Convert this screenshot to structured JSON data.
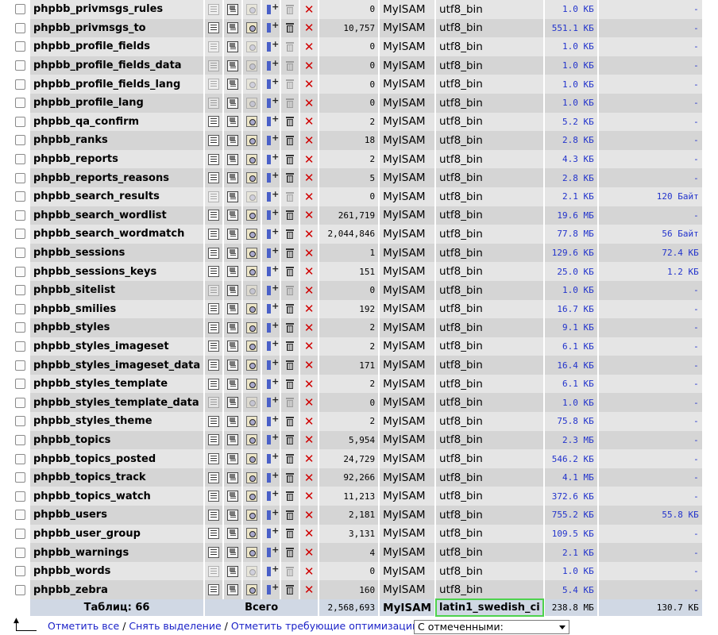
{
  "tables": [
    {
      "name": "phpbb_privmsgs_rules",
      "rows": "0",
      "engine": "MyISAM",
      "collation": "utf8_bin",
      "size": "1.0 КБ",
      "overhead": "-",
      "empty": true
    },
    {
      "name": "phpbb_privmsgs_to",
      "rows": "10,757",
      "engine": "MyISAM",
      "collation": "utf8_bin",
      "size": "551.1 КБ",
      "overhead": "-",
      "empty": false
    },
    {
      "name": "phpbb_profile_fields",
      "rows": "0",
      "engine": "MyISAM",
      "collation": "utf8_bin",
      "size": "1.0 КБ",
      "overhead": "-",
      "empty": true
    },
    {
      "name": "phpbb_profile_fields_data",
      "rows": "0",
      "engine": "MyISAM",
      "collation": "utf8_bin",
      "size": "1.0 КБ",
      "overhead": "-",
      "empty": true
    },
    {
      "name": "phpbb_profile_fields_lang",
      "rows": "0",
      "engine": "MyISAM",
      "collation": "utf8_bin",
      "size": "1.0 КБ",
      "overhead": "-",
      "empty": true
    },
    {
      "name": "phpbb_profile_lang",
      "rows": "0",
      "engine": "MyISAM",
      "collation": "utf8_bin",
      "size": "1.0 КБ",
      "overhead": "-",
      "empty": true
    },
    {
      "name": "phpbb_qa_confirm",
      "rows": "2",
      "engine": "MyISAM",
      "collation": "utf8_bin",
      "size": "5.2 КБ",
      "overhead": "-",
      "empty": false
    },
    {
      "name": "phpbb_ranks",
      "rows": "18",
      "engine": "MyISAM",
      "collation": "utf8_bin",
      "size": "2.8 КБ",
      "overhead": "-",
      "empty": false
    },
    {
      "name": "phpbb_reports",
      "rows": "2",
      "engine": "MyISAM",
      "collation": "utf8_bin",
      "size": "4.3 КБ",
      "overhead": "-",
      "empty": false
    },
    {
      "name": "phpbb_reports_reasons",
      "rows": "5",
      "engine": "MyISAM",
      "collation": "utf8_bin",
      "size": "2.8 КБ",
      "overhead": "-",
      "empty": false
    },
    {
      "name": "phpbb_search_results",
      "rows": "0",
      "engine": "MyISAM",
      "collation": "utf8_bin",
      "size": "2.1 КБ",
      "overhead": "120 Байт",
      "empty": true
    },
    {
      "name": "phpbb_search_wordlist",
      "rows": "261,719",
      "engine": "MyISAM",
      "collation": "utf8_bin",
      "size": "19.6 МБ",
      "overhead": "-",
      "empty": false
    },
    {
      "name": "phpbb_search_wordmatch",
      "rows": "2,044,846",
      "engine": "MyISAM",
      "collation": "utf8_bin",
      "size": "77.8 МБ",
      "overhead": "56 Байт",
      "empty": false
    },
    {
      "name": "phpbb_sessions",
      "rows": "1",
      "engine": "MyISAM",
      "collation": "utf8_bin",
      "size": "129.6 КБ",
      "overhead": "72.4 КБ",
      "empty": false
    },
    {
      "name": "phpbb_sessions_keys",
      "rows": "151",
      "engine": "MyISAM",
      "collation": "utf8_bin",
      "size": "25.0 КБ",
      "overhead": "1.2 КБ",
      "empty": false
    },
    {
      "name": "phpbb_sitelist",
      "rows": "0",
      "engine": "MyISAM",
      "collation": "utf8_bin",
      "size": "1.0 КБ",
      "overhead": "-",
      "empty": true
    },
    {
      "name": "phpbb_smilies",
      "rows": "192",
      "engine": "MyISAM",
      "collation": "utf8_bin",
      "size": "16.7 КБ",
      "overhead": "-",
      "empty": false
    },
    {
      "name": "phpbb_styles",
      "rows": "2",
      "engine": "MyISAM",
      "collation": "utf8_bin",
      "size": "9.1 КБ",
      "overhead": "-",
      "empty": false
    },
    {
      "name": "phpbb_styles_imageset",
      "rows": "2",
      "engine": "MyISAM",
      "collation": "utf8_bin",
      "size": "6.1 КБ",
      "overhead": "-",
      "empty": false
    },
    {
      "name": "phpbb_styles_imageset_data",
      "rows": "171",
      "engine": "MyISAM",
      "collation": "utf8_bin",
      "size": "16.4 КБ",
      "overhead": "-",
      "empty": false
    },
    {
      "name": "phpbb_styles_template",
      "rows": "2",
      "engine": "MyISAM",
      "collation": "utf8_bin",
      "size": "6.1 КБ",
      "overhead": "-",
      "empty": false
    },
    {
      "name": "phpbb_styles_template_data",
      "rows": "0",
      "engine": "MyISAM",
      "collation": "utf8_bin",
      "size": "1.0 КБ",
      "overhead": "-",
      "empty": true
    },
    {
      "name": "phpbb_styles_theme",
      "rows": "2",
      "engine": "MyISAM",
      "collation": "utf8_bin",
      "size": "75.8 КБ",
      "overhead": "-",
      "empty": false
    },
    {
      "name": "phpbb_topics",
      "rows": "5,954",
      "engine": "MyISAM",
      "collation": "utf8_bin",
      "size": "2.3 МБ",
      "overhead": "-",
      "empty": false
    },
    {
      "name": "phpbb_topics_posted",
      "rows": "24,729",
      "engine": "MyISAM",
      "collation": "utf8_bin",
      "size": "546.2 КБ",
      "overhead": "-",
      "empty": false
    },
    {
      "name": "phpbb_topics_track",
      "rows": "92,266",
      "engine": "MyISAM",
      "collation": "utf8_bin",
      "size": "4.1 МБ",
      "overhead": "-",
      "empty": false
    },
    {
      "name": "phpbb_topics_watch",
      "rows": "11,213",
      "engine": "MyISAM",
      "collation": "utf8_bin",
      "size": "372.6 КБ",
      "overhead": "-",
      "empty": false
    },
    {
      "name": "phpbb_users",
      "rows": "2,181",
      "engine": "MyISAM",
      "collation": "utf8_bin",
      "size": "755.2 КБ",
      "overhead": "55.8 КБ",
      "empty": false
    },
    {
      "name": "phpbb_user_group",
      "rows": "3,131",
      "engine": "MyISAM",
      "collation": "utf8_bin",
      "size": "109.5 КБ",
      "overhead": "-",
      "empty": false
    },
    {
      "name": "phpbb_warnings",
      "rows": "4",
      "engine": "MyISAM",
      "collation": "utf8_bin",
      "size": "2.1 КБ",
      "overhead": "-",
      "empty": false
    },
    {
      "name": "phpbb_words",
      "rows": "0",
      "engine": "MyISAM",
      "collation": "utf8_bin",
      "size": "1.0 КБ",
      "overhead": "-",
      "empty": true
    },
    {
      "name": "phpbb_zebra",
      "rows": "160",
      "engine": "MyISAM",
      "collation": "utf8_bin",
      "size": "5.4 КБ",
      "overhead": "-",
      "empty": false
    }
  ],
  "footer": {
    "tables_count": "Таблиц: 66",
    "total_label": "Всего",
    "rows_total": "2,568,693",
    "engine": "MyISAM",
    "collation": "latin1_swedish_ci",
    "size_total": "238.8 МБ",
    "overhead_total": "130.7 КБ"
  },
  "actions": {
    "check_all": "Отметить все",
    "uncheck_all": "Снять выделение",
    "check_overhead": "Отметить требующие оптимизации",
    "separator": "/",
    "with_selected": "С отмеченными:"
  },
  "colors": {
    "link": "#1b22c8",
    "drop": "#d00000",
    "highlight_outline": "#4dd24d"
  }
}
